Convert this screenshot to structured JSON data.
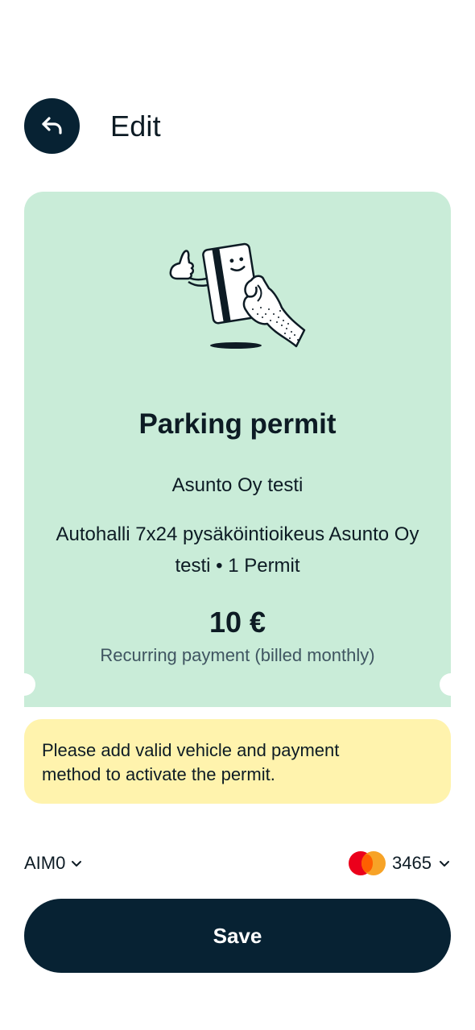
{
  "header": {
    "title": "Edit",
    "back_icon": "undo-arrow-icon"
  },
  "card": {
    "background": "#c9ecd8",
    "illustration": "hand-holding-card-illustration",
    "title": "Parking permit",
    "company": "Asunto Oy testi",
    "product_line1": "Autohalli 7x24 pysäköintioikeus Asunto Oy",
    "product_line2": "testi • 1 Permit",
    "price": "10 €",
    "billing": "Recurring payment (billed monthly)"
  },
  "warning": {
    "line1": "Please add valid vehicle and payment",
    "line2": "method to activate the permit.",
    "background": "#fff3ad"
  },
  "vehicle": {
    "value": "AIM0",
    "icon": "chevron-down-icon"
  },
  "payment": {
    "card_brand_icon": "mastercard-icon",
    "last4": "3465",
    "icon": "chevron-down-icon"
  },
  "actions": {
    "save_label": "Save"
  },
  "colors": {
    "primary_dark": "#072233",
    "mastercard_red": "#eb001b",
    "mastercard_orange": "#f79e1b"
  }
}
